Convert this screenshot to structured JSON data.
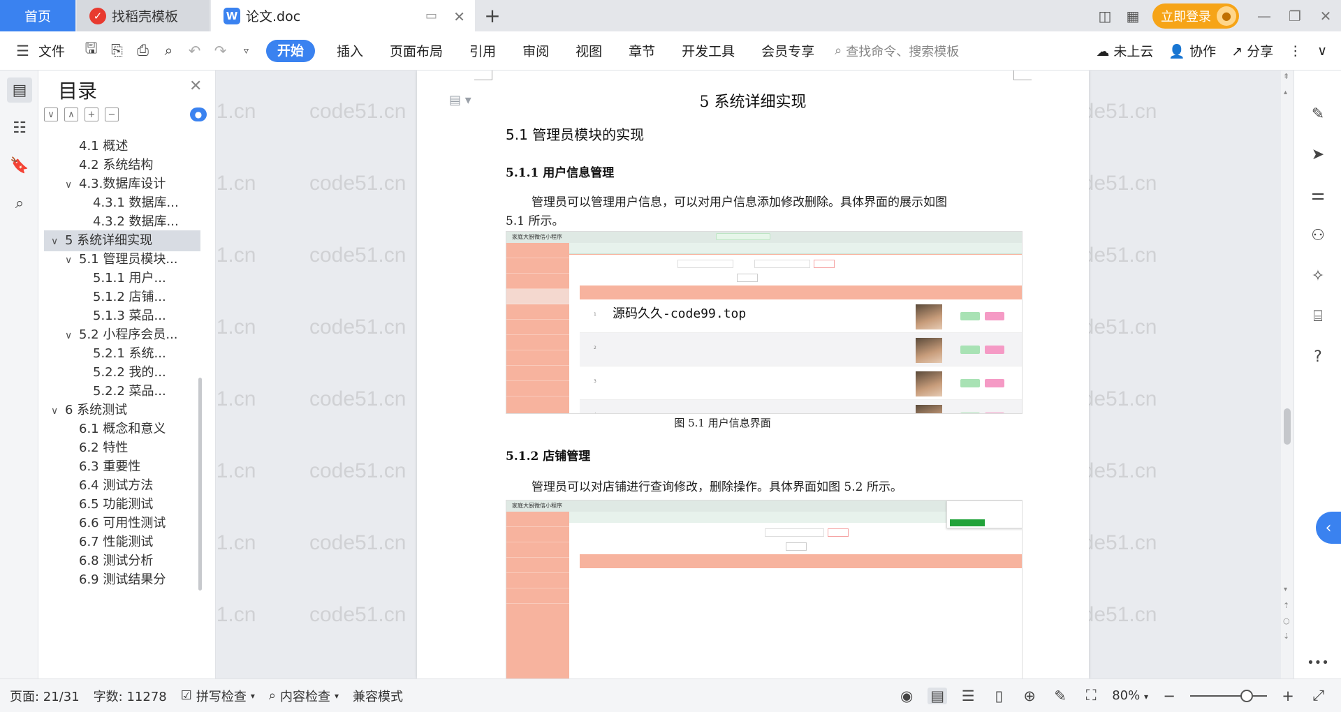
{
  "tabs": {
    "home": "首页",
    "templates": "找稻壳模板",
    "document": "论文.doc"
  },
  "titlebar": {
    "login": "立即登录"
  },
  "ribbon": {
    "file": "文件",
    "tabs": [
      "开始",
      "插入",
      "页面布局",
      "引用",
      "审阅",
      "视图",
      "章节",
      "开发工具",
      "会员专享"
    ],
    "search_placeholder": "查找命令、搜索模板",
    "cloud": "未上云",
    "collab": "协作",
    "share": "分享"
  },
  "outline": {
    "title": "目录",
    "items": [
      {
        "label": "4.1 概述",
        "level": 2,
        "arrow": ""
      },
      {
        "label": "4.2 系统结构",
        "level": 2,
        "arrow": ""
      },
      {
        "label": "4.3.数据库设计",
        "level": 2,
        "arrow": "∨"
      },
      {
        "label": "4.3.1 数据库...",
        "level": 3,
        "arrow": ""
      },
      {
        "label": "4.3.2 数据库...",
        "level": 3,
        "arrow": ""
      },
      {
        "label": "5 系统详细实现",
        "level": 1,
        "arrow": "∨",
        "selected": true
      },
      {
        "label": "5.1 管理员模块...",
        "level": 2,
        "arrow": "∨"
      },
      {
        "label": "5.1.1 用户...",
        "level": 3,
        "arrow": ""
      },
      {
        "label": "5.1.2 店铺...",
        "level": 3,
        "arrow": ""
      },
      {
        "label": "5.1.3 菜品...",
        "level": 3,
        "arrow": ""
      },
      {
        "label": "5.2 小程序会员...",
        "level": 2,
        "arrow": "∨"
      },
      {
        "label": "5.2.1 系统...",
        "level": 3,
        "arrow": ""
      },
      {
        "label": "5.2.2 我的...",
        "level": 3,
        "arrow": ""
      },
      {
        "label": "5.2.2 菜品...",
        "level": 3,
        "arrow": ""
      },
      {
        "label": "6 系统测试",
        "level": 1,
        "arrow": "∨"
      },
      {
        "label": "6.1 概念和意义",
        "level": 2,
        "arrow": ""
      },
      {
        "label": "6.2 特性",
        "level": 2,
        "arrow": ""
      },
      {
        "label": "6.3 重要性",
        "level": 2,
        "arrow": ""
      },
      {
        "label": "6.4 测试方法",
        "level": 2,
        "arrow": ""
      },
      {
        "label": "6.5 功能测试",
        "level": 2,
        "arrow": ""
      },
      {
        "label": "6.6 可用性测试",
        "level": 2,
        "arrow": ""
      },
      {
        "label": "6.7 性能测试",
        "level": 2,
        "arrow": ""
      },
      {
        "label": "6.8 测试分析",
        "level": 2,
        "arrow": ""
      },
      {
        "label": "6.9 测试结果分",
        "level": 2,
        "arrow": ""
      }
    ]
  },
  "document": {
    "chapter_title": "5 系统详细实现",
    "h2": "5.1 管理员模块的实现",
    "h3_1": "5.1.1 用户信息管理",
    "para_1a": "管理员可以管理用户信息，可以对用户信息添加修改删除。具体界面的展示如图",
    "para_1b": "5.1 所示。",
    "figure_1_caption": "图 5.1 用户信息界面",
    "figure_1_title": "家庭大厨微信小程序",
    "figure_1_watermark": "源码久久-code99.top",
    "h3_2": "5.1.2 店铺管理",
    "para_2": "管理员可以对店铺进行查询修改，删除操作。具体界面如图 5.2 所示。",
    "figure_2_title": "家庭大厨微信小程序"
  },
  "watermark_text": "code51.cn",
  "statusbar": {
    "page": "页面: 21/31",
    "words": "字数: 11278",
    "spell": "拼写检查",
    "content": "内容检查",
    "compat": "兼容模式",
    "zoom": "80%"
  },
  "colors": {
    "accent": "#3a82f0",
    "login": "#f6a417",
    "figure_salmon": "#f7b39e"
  }
}
